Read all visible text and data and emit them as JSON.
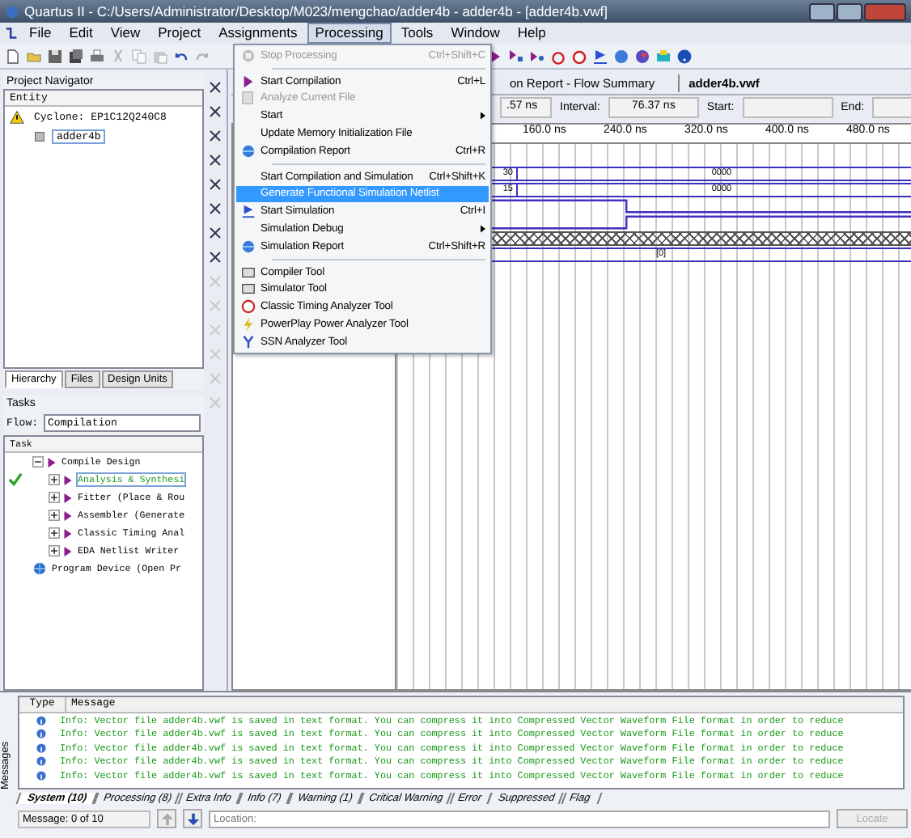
{
  "window": {
    "title": "Quartus II - C:/Users/Administrator/Desktop/M023/mengchao/adder4b - adder4b - [adder4b.vwf]"
  },
  "menu_bar": [
    {
      "label": "File",
      "selected": false
    },
    {
      "label": "Edit",
      "selected": false
    },
    {
      "label": "View",
      "selected": false
    },
    {
      "label": "Project",
      "selected": false
    },
    {
      "label": "Assignments",
      "selected": false
    },
    {
      "label": "Processing",
      "selected": true
    },
    {
      "label": "Tools",
      "selected": false
    },
    {
      "label": "Window",
      "selected": false
    },
    {
      "label": "Help",
      "selected": false
    }
  ],
  "processing_menu": [
    {
      "kind": "item",
      "label": "Stop Processing",
      "shortcut": "Ctrl+Shift+C",
      "disabled": true,
      "selected": false
    },
    {
      "kind": "separator"
    },
    {
      "kind": "item",
      "label": "Start Compilation",
      "shortcut": "Ctrl+L",
      "disabled": false,
      "selected": false
    },
    {
      "kind": "item",
      "label": "Analyze Current File",
      "disabled": true,
      "selected": false
    },
    {
      "kind": "submenu",
      "label": "Start",
      "disabled": false,
      "selected": false
    },
    {
      "kind": "item",
      "label": "Update Memory Initialization File",
      "disabled": false,
      "selected": false
    },
    {
      "kind": "item",
      "label": "Compilation Report",
      "shortcut": "Ctrl+R",
      "disabled": false,
      "selected": false
    },
    {
      "kind": "separator"
    },
    {
      "kind": "item",
      "label": "Start Compilation and Simulation",
      "shortcut": "Ctrl+Shift+K",
      "disabled": false,
      "selected": false
    },
    {
      "kind": "item",
      "label": "Generate Functional Simulation Netlist",
      "disabled": false,
      "selected": true
    },
    {
      "kind": "item",
      "label": "Start Simulation",
      "shortcut": "Ctrl+I",
      "disabled": false,
      "selected": false
    },
    {
      "kind": "submenu",
      "label": "Simulation Debug",
      "disabled": false,
      "selected": false
    },
    {
      "kind": "item",
      "label": "Simulation Report",
      "shortcut": "Ctrl+Shift+R",
      "disabled": false,
      "selected": false
    },
    {
      "kind": "separator"
    },
    {
      "kind": "item",
      "label": "Compiler Tool",
      "disabled": false,
      "selected": false
    },
    {
      "kind": "item",
      "label": "Simulator Tool",
      "disabled": false,
      "selected": false
    },
    {
      "kind": "item",
      "label": "Classic Timing Analyzer Tool",
      "disabled": false,
      "selected": false
    },
    {
      "kind": "item",
      "label": "PowerPlay Power Analyzer Tool",
      "disabled": false,
      "selected": false
    },
    {
      "kind": "item",
      "label": "SSN Analyzer Tool",
      "disabled": false,
      "selected": false
    }
  ],
  "project_navigator": {
    "title": "Project Navigator",
    "column": "Entity",
    "tree": [
      {
        "label": "Cyclone: EP1C12Q240C8",
        "selected": false,
        "children": [
          {
            "label": "adder4b",
            "selected": true
          }
        ]
      }
    ],
    "tabs": [
      {
        "label": "Hierarchy",
        "selected": true
      },
      {
        "label": "Files",
        "selected": false
      },
      {
        "label": "Design Units",
        "selected": false
      }
    ]
  },
  "tasks": {
    "title": "Tasks",
    "flow_label": "Flow:",
    "flow": "Compilation",
    "column": "Task",
    "tree": [
      {
        "label": "Compile Design",
        "expanded": true,
        "done": false,
        "selected": false,
        "children": [
          {
            "label": "Analysis & Synthesi",
            "expanded": false,
            "done": true,
            "selected": true
          },
          {
            "label": "Fitter (Place & Rou",
            "expanded": false,
            "done": false,
            "selected": false
          },
          {
            "label": "Assembler (Generate",
            "expanded": false,
            "done": false,
            "selected": false
          },
          {
            "label": "Classic Timing Anal",
            "expanded": false,
            "done": false,
            "selected": false
          },
          {
            "label": "EDA Netlist Writer",
            "expanded": false,
            "done": false,
            "selected": false
          }
        ]
      },
      {
        "label": "Program Device (Open Pr",
        "done": false,
        "selected": false
      }
    ]
  },
  "editor": {
    "tabs": [
      {
        "label": "on Report - Flow Summary",
        "selected": false
      },
      {
        "label": "adder4b.vwf",
        "selected": true
      }
    ],
    "master_time": ".57 ns",
    "interval_label": "Interval:",
    "interval": "76.37 ns",
    "start_label": "Start:",
    "end_label": "End:",
    "ruler": [
      "160.0 ns",
      "240.0 ns",
      "320.0 ns",
      "400.0 ns",
      "480.0 ns"
    ],
    "rows": [
      {
        "kind": "bus",
        "values": [
          "30",
          "0000"
        ]
      },
      {
        "kind": "bus",
        "values": [
          "15",
          "0000"
        ]
      },
      {
        "kind": "bit"
      },
      {
        "kind": "bit"
      },
      {
        "kind": "unknown"
      },
      {
        "kind": "bus",
        "values": [
          "[0]"
        ]
      }
    ]
  },
  "messages": {
    "title": "Messages",
    "columns": [
      "Type",
      "Message"
    ],
    "rows": [
      "Info: Vector file adder4b.vwf is saved in text format. You can compress it into Compressed Vector Waveform File format in order to reduce",
      "Info: Vector file adder4b.vwf is saved in text format. You can compress it into Compressed Vector Waveform File format in order to reduce",
      "Info: Vector file adder4b.vwf is saved in text format. You can compress it into Compressed Vector Waveform File format in order to reduce",
      "Info: Vector file adder4b.vwf is saved in text format. You can compress it into Compressed Vector Waveform File format in order to reduce",
      "Info: Vector file adder4b.vwf is saved in text format. You can compress it into Compressed Vector Waveform File format in order to reduce"
    ],
    "tabs": [
      {
        "label": "System (10)",
        "selected": true
      },
      {
        "label": "Processing (8)",
        "selected": false
      },
      {
        "label": "Extra Info",
        "selected": false
      },
      {
        "label": "Info (7)",
        "selected": false
      },
      {
        "label": "Warning (1)",
        "selected": false
      },
      {
        "label": "Critical Warning",
        "selected": false
      },
      {
        "label": "Error",
        "selected": false
      },
      {
        "label": "Suppressed",
        "selected": false
      },
      {
        "label": "Flag",
        "selected": false
      }
    ],
    "status": "Message: 0 of 10",
    "location_placeholder": "Location:",
    "locate_button": {
      "label": "Locate",
      "disabled": true
    }
  }
}
